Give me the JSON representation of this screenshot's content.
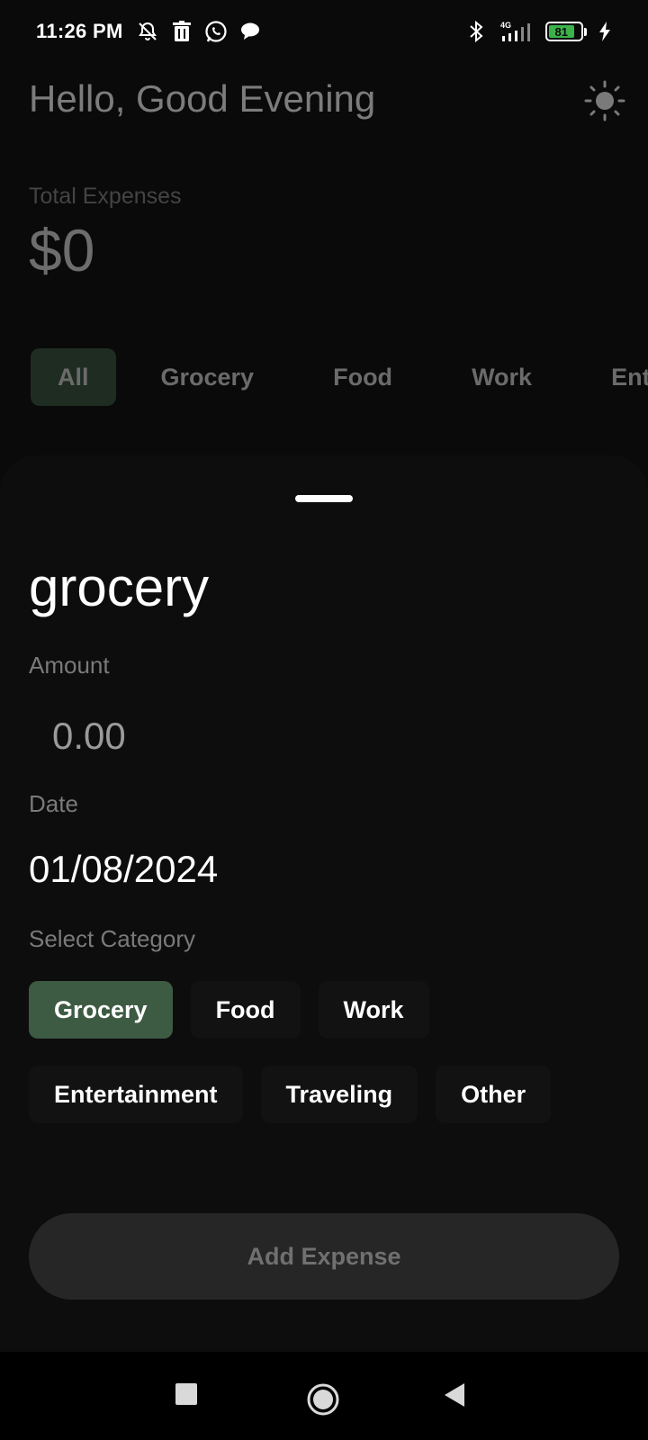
{
  "status_bar": {
    "time": "11:26 PM",
    "network": "4G",
    "battery": "81",
    "icons": [
      "notifications-off-icon",
      "trash-icon",
      "whatsapp-icon",
      "chat-bubble-icon",
      "bluetooth-icon",
      "signal-icon",
      "battery-icon",
      "charging-icon"
    ]
  },
  "header": {
    "greeting": "Hello, Good Evening",
    "theme_icon": "sun-icon"
  },
  "summary": {
    "label": "Total Expenses",
    "value": "$0"
  },
  "filter_tabs": [
    {
      "label": "All",
      "active": true
    },
    {
      "label": "Grocery"
    },
    {
      "label": "Food"
    },
    {
      "label": "Work"
    },
    {
      "label": "Entertainment"
    }
  ],
  "sheet": {
    "title": "grocery",
    "amount_label": "Amount",
    "amount_placeholder": "0.00",
    "date_label": "Date",
    "date_value": "01/08/2024",
    "category_label": "Select Category",
    "categories": [
      "Grocery",
      "Food",
      "Work",
      "Entertainment",
      "Traveling",
      "Other"
    ],
    "selected_category": "Grocery",
    "add_button": "Add Expense"
  },
  "colors": {
    "background": "#0a0a0a",
    "sheet": "#0d0d0d",
    "accent_selected": "#3d5a42",
    "active_tab": "#1f2c22",
    "battery": "#3bb34a"
  },
  "nav_bar": {
    "icons": [
      "recents-square-icon",
      "home-circle-icon",
      "back-triangle-icon"
    ]
  }
}
